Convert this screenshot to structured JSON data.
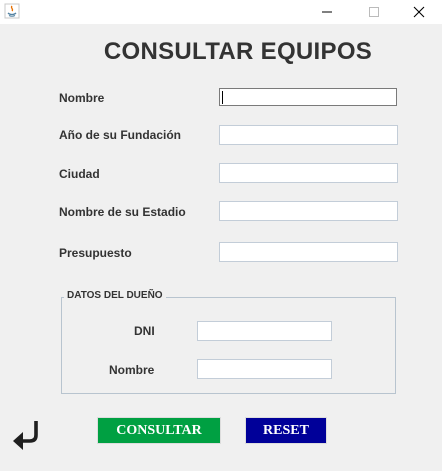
{
  "window": {
    "icon": "java-icon",
    "controls": [
      "minimize-icon",
      "maximize-icon",
      "close-icon"
    ]
  },
  "form": {
    "title": "CONSULTAR EQUIPOS",
    "labels": {
      "nombre": "Nombre",
      "fundacion": "Año de su Fundación",
      "ciudad": "Ciudad",
      "estadio": "Nombre de su Estadio",
      "presupuesto": "Presupuesto"
    },
    "values": {
      "nombre": "",
      "fundacion": "",
      "ciudad": "",
      "estadio": "",
      "presupuesto": ""
    }
  },
  "owner": {
    "group_title": "DATOS DEL DUEÑO",
    "labels": {
      "dni": "DNI",
      "nombre": "Nombre"
    },
    "values": {
      "dni": "",
      "nombre": ""
    }
  },
  "buttons": {
    "back_icon": "back-arrow-icon",
    "consultar": "CONSULTAR",
    "reset": "RESET"
  },
  "colors": {
    "consultar_bg": "#00a042",
    "reset_bg": "#000099",
    "background": "#f0f0f0"
  }
}
